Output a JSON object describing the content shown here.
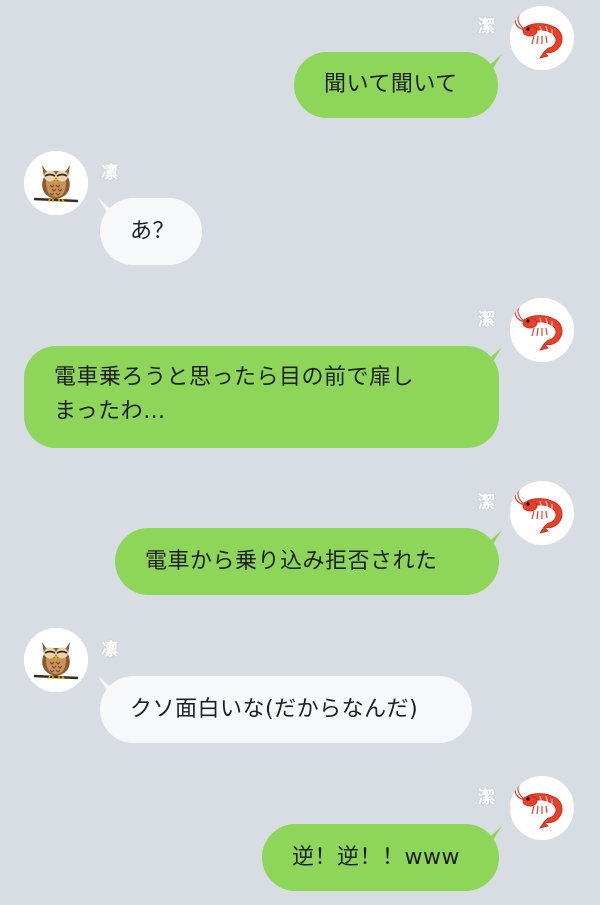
{
  "senders": {
    "right_name": "潔",
    "left_name": "凛"
  },
  "messages": [
    {
      "side": "right",
      "text": "聞いて聞いて"
    },
    {
      "side": "left",
      "text": "あ？"
    },
    {
      "side": "right",
      "lines": [
        "電車乗ろうと思ったら目の前で扉し",
        "まったわ…"
      ]
    },
    {
      "side": "right",
      "text": "電車から乗り込み拒否された"
    },
    {
      "side": "left",
      "text": "クソ面白いな(だからなんだ)"
    },
    {
      "side": "right",
      "text": "逆！逆！！www"
    }
  ],
  "colors": {
    "background": "#d8dde4",
    "right_bubble": "#8dd65a",
    "left_bubble": "#f7f8f9"
  },
  "icons": {
    "right_avatar": "shrimp-icon",
    "left_avatar": "owl-icon"
  }
}
